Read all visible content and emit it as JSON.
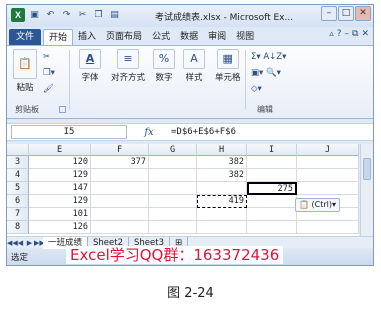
{
  "window": {
    "title": "考试成绩表.xlsx - Microsoft Ex...",
    "logo": "X",
    "qat_icons": [
      "save-icon",
      "undo-icon",
      "redo-icon",
      "cut-icon",
      "copy-icon",
      "paste-icon"
    ],
    "controls": [
      "minimize-icon",
      "maximize-icon",
      "close-icon"
    ]
  },
  "ribbon_tabs": [
    "文件",
    "开始",
    "插入",
    "页面布局",
    "公式",
    "数据",
    "审阅",
    "视图"
  ],
  "active_tab": "开始",
  "ribbon": {
    "paste": "粘贴",
    "clipboard": "剪贴板",
    "font": "字体",
    "alignment": "对齐方式",
    "number": "数字",
    "styles": "样式",
    "cells": "单元格",
    "editing": "编辑",
    "sum_symbol": "Σ",
    "percent_symbol": "%"
  },
  "formula_bar": {
    "name_box": "I5",
    "fx": "fx",
    "formula": "=D$6+E$6+F$6"
  },
  "columns": [
    "E",
    "F",
    "G",
    "H",
    "I",
    "J"
  ],
  "rows": [
    {
      "num": "3",
      "E": "120",
      "F": "377",
      "H": "382",
      "I": ""
    },
    {
      "num": "4",
      "E": "129",
      "F": "",
      "H": "382",
      "I": ""
    },
    {
      "num": "5",
      "E": "147",
      "F": "",
      "H": "",
      "I": "275"
    },
    {
      "num": "6",
      "E": "129",
      "F": "",
      "H": "419",
      "I": ""
    },
    {
      "num": "7",
      "E": "101",
      "F": "",
      "H": "",
      "I": ""
    },
    {
      "num": "8",
      "E": "126",
      "F": "",
      "H": "",
      "I": ""
    }
  ],
  "paste_options": "(Ctrl)▾",
  "sheets": [
    "一班成绩",
    "Sheet2",
    "Sheet3"
  ],
  "active_sheet": "一班成绩",
  "status": "选定",
  "watermark": "Excel学习QQ群：163372436",
  "figure_caption": "图 2-24",
  "colors": {
    "file_tab": "#2b5797",
    "watermark": "#e0143c",
    "selected_border": "#000000"
  }
}
